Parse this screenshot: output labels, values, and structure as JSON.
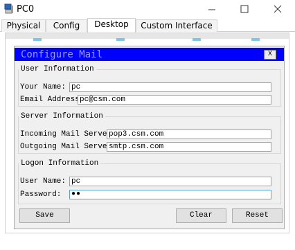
{
  "window": {
    "title": "PC0",
    "icons": {
      "app": "pc-device-icon",
      "minimize": "minimize-icon",
      "maximize": "maximize-icon",
      "close": "close-icon"
    }
  },
  "tabs": [
    {
      "label": "Physical",
      "active": false
    },
    {
      "label": "Config",
      "active": false
    },
    {
      "label": "Desktop",
      "active": true
    },
    {
      "label": "Custom Interface",
      "active": false
    }
  ],
  "mail": {
    "title": "Configure Mail",
    "close_label": "X",
    "user_info": {
      "legend": "User Information",
      "name_label": "Your Name:",
      "name_value": "pc",
      "email_label": "Email Address",
      "email_value": "pc@csm.com"
    },
    "server_info": {
      "legend": "Server Information",
      "incoming_label": "Incoming Mail Server",
      "incoming_value": "pop3.csm.com",
      "outgoing_label": "Outgoing Mail Server",
      "outgoing_value": "smtp.csm.com"
    },
    "logon_info": {
      "legend": "Logon Information",
      "username_label": "User Name:",
      "username_value": "pc",
      "password_label": "Password:",
      "password_value": "●●"
    },
    "buttons": {
      "save": "Save",
      "clear": "Clear",
      "reset": "Reset"
    }
  },
  "colors": {
    "header_blue": "#0000ff",
    "tab_active_bg": "#ffffff",
    "focus_border": "#56a0d6"
  }
}
